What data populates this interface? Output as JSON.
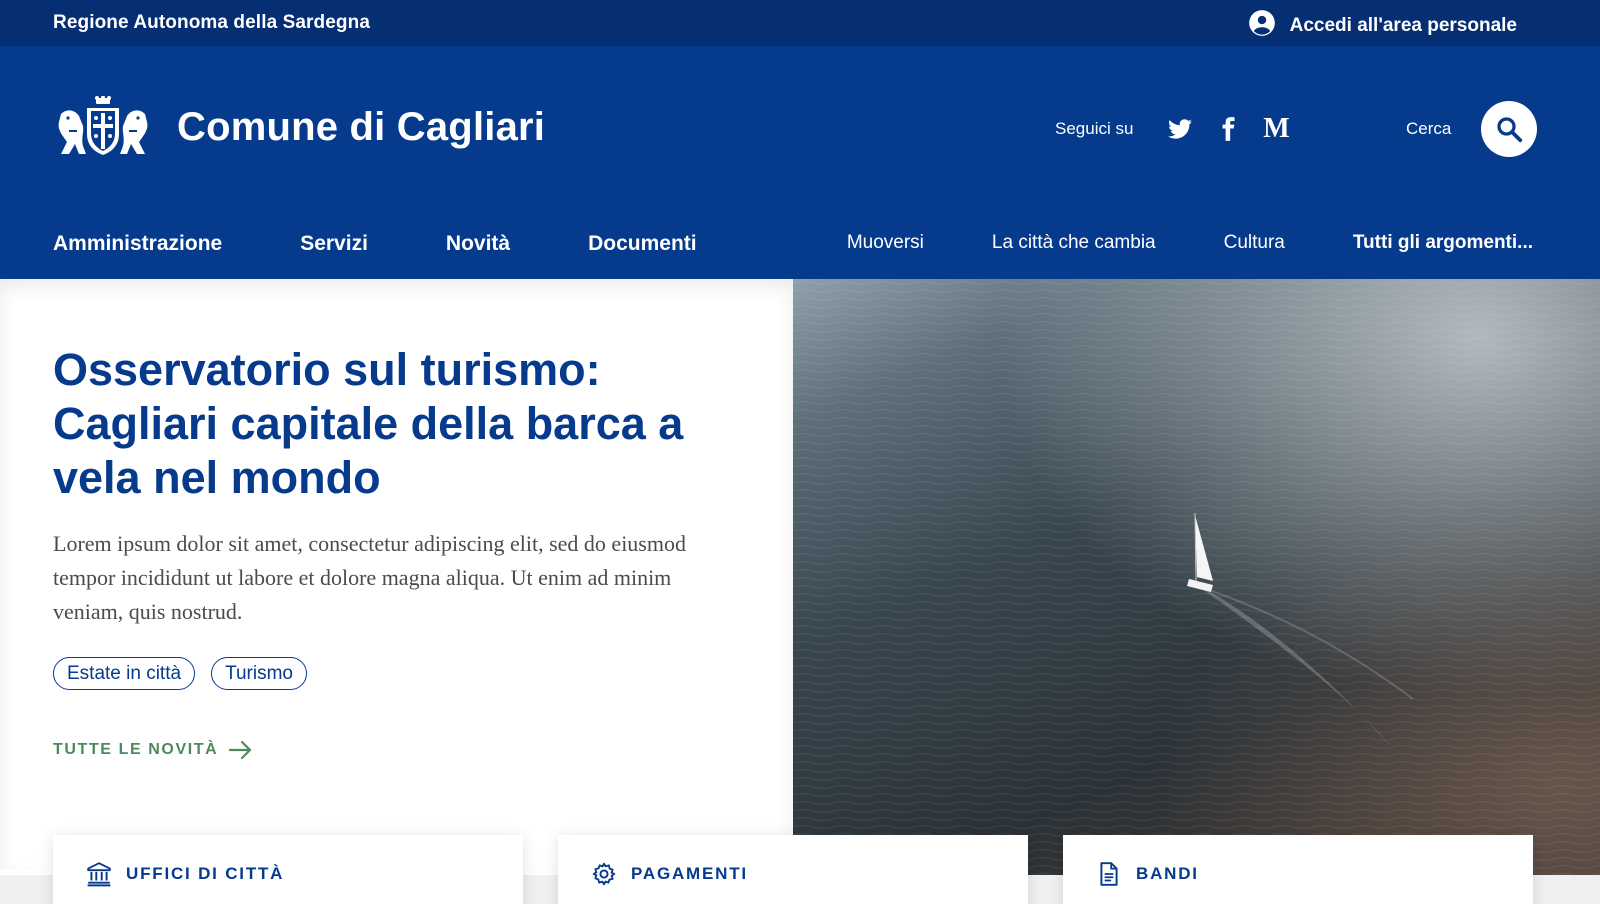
{
  "topbar": {
    "region": "Regione Autonoma della Sardegna",
    "login_label": "Accedi all'area personale",
    "login_icon": "user-circle-icon"
  },
  "header": {
    "site_name": "Comune di Cagliari",
    "logo": "coat-of-arms-logo",
    "follow_label": "Seguici su",
    "social": [
      "twitter-icon",
      "facebook-icon",
      "medium-icon"
    ],
    "medium_glyph": "M",
    "search_label": "Cerca",
    "search_icon": "search-icon"
  },
  "nav": {
    "main": [
      "Amministrazione",
      "Servizi",
      "Novità",
      "Documenti"
    ],
    "topics": [
      "Muoversi",
      "La città che cambia",
      "Cultura",
      "Tutti gli argomenti..."
    ]
  },
  "hero": {
    "title": "Osservatorio sul turismo: Cagliari capitale della barca a vela nel mondo",
    "text": "Lorem ipsum dolor sit amet, consectetur adipiscing elit, sed do eiusmod tempor incididunt ut labore et dolore magna aliqua. Ut enim ad minim veniam, quis nostrud.",
    "tags": [
      "Estate in città",
      "Turismo"
    ],
    "all_news": "TUTTE LE NOVITÀ",
    "image": "aerial-sea-sailboat-photo"
  },
  "cards": [
    {
      "label": "UFFICI DI CITTÀ",
      "icon": "institution-icon"
    },
    {
      "label": "PAGAMENTI",
      "icon": "gear-icon"
    },
    {
      "label": "BANDI",
      "icon": "document-icon"
    }
  ],
  "colors": {
    "topbar": "#062e73",
    "header": "#063a8c",
    "primary_text": "#063a8c",
    "link_green": "#4d8a5a"
  }
}
